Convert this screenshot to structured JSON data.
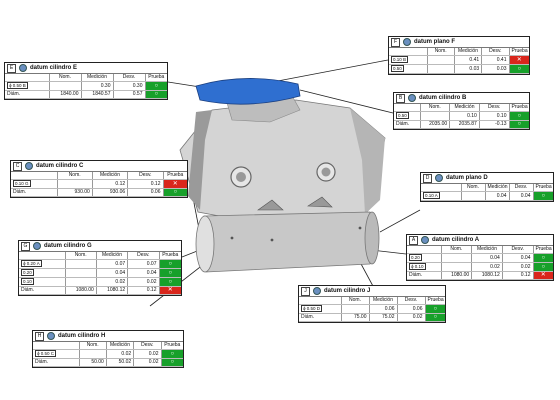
{
  "colors": {
    "ok": "#17a02a",
    "bad": "#d9261c",
    "top_face": "#2f6fd0",
    "body": "#d4d4d4"
  },
  "icons": {
    "datum": "datum-cylinder-icon",
    "ok": "circle-ok-icon",
    "bad": "cross-icon"
  },
  "panels": {
    "E": {
      "letter": "E",
      "title": "datum cilindro E",
      "headers": [
        "Nom.",
        "Medición",
        "Desv.",
        "Prueba"
      ],
      "rows": [
        {
          "fcf": "ϕ 0.50 B",
          "nom": "",
          "med": "0.30",
          "dev": "0.30",
          "status": "ok"
        },
        {
          "label": "Diám.",
          "nom": "1840.00",
          "med": "1840.57",
          "dev": "0.57",
          "status": "ok"
        }
      ]
    },
    "F": {
      "letter": "F",
      "title": "datum plano F",
      "headers": [
        "Nom.",
        "Medición",
        "Desv.",
        "Prueba"
      ],
      "rows": [
        {
          "fcf": "0.10 B",
          "nom": "",
          "med": "0.41",
          "dev": "0.41",
          "status": "bad"
        },
        {
          "fcf": "0.50",
          "nom": "",
          "med": "0.03",
          "dev": "0.03",
          "status": "ok"
        }
      ]
    },
    "B": {
      "letter": "B",
      "title": "datum cilindro B",
      "headers": [
        "Nom.",
        "Medición",
        "Desv.",
        "Prueba"
      ],
      "rows": [
        {
          "fcf": "0.50",
          "nom": "",
          "med": "0.10",
          "dev": "0.10",
          "status": "ok"
        },
        {
          "label": "Diám.",
          "nom": "2035.00",
          "med": "2035.87",
          "dev": "-0.13",
          "status": "ok"
        }
      ]
    },
    "C": {
      "letter": "C",
      "title": "datum cilindro C",
      "headers": [
        "Nom.",
        "Medición",
        "Desv.",
        "Prueba"
      ],
      "rows": [
        {
          "fcf": "0.10 G",
          "nom": "",
          "med": "0.12",
          "dev": "0.12",
          "status": "bad"
        },
        {
          "label": "Diám.",
          "nom": "930.00",
          "med": "930.06",
          "dev": "0.06",
          "status": "ok"
        }
      ]
    },
    "D": {
      "letter": "D",
      "title": "datum plano D",
      "headers": [
        "Nom.",
        "Medición",
        "Desv.",
        "Prueba"
      ],
      "rows": [
        {
          "fcf": "0.10 A",
          "nom": "",
          "med": "0.04",
          "dev": "0.04",
          "status": "ok"
        }
      ]
    },
    "G": {
      "letter": "G",
      "title": "datum cilindro G",
      "headers": [
        "Nom.",
        "Medición",
        "Desv.",
        "Prueba"
      ],
      "rows": [
        {
          "fcf": "ϕ 0.20 A",
          "nom": "",
          "med": "0.07",
          "dev": "0.07",
          "status": "ok"
        },
        {
          "fcf": "0.20",
          "nom": "",
          "med": "0.04",
          "dev": "0.04",
          "status": "ok"
        },
        {
          "fcf": "0.10",
          "nom": "",
          "med": "0.02",
          "dev": "0.02",
          "status": "ok"
        },
        {
          "label": "Diám.",
          "nom": "1080.00",
          "med": "1080.12",
          "dev": "0.12",
          "status": "bad"
        }
      ]
    },
    "A": {
      "letter": "A",
      "title": "datum cilindro A",
      "headers": [
        "Nom.",
        "Medición",
        "Desv.",
        "Prueba"
      ],
      "rows": [
        {
          "fcf": "0.20",
          "nom": "",
          "med": "0.04",
          "dev": "0.04",
          "status": "ok"
        },
        {
          "fcf": "ϕ 0.10",
          "nom": "",
          "med": "0.02",
          "dev": "0.02",
          "status": "ok"
        },
        {
          "label": "Diám.",
          "nom": "1080.00",
          "med": "1080.12",
          "dev": "0.12",
          "status": "bad"
        }
      ]
    },
    "H": {
      "letter": "H",
      "title": "datum cilindro H",
      "headers": [
        "Nom.",
        "Medición",
        "Desv.",
        "Prueba"
      ],
      "rows": [
        {
          "fcf": "ϕ 0.50 C",
          "nom": "",
          "med": "0.02",
          "dev": "0.02",
          "status": "ok"
        },
        {
          "label": "Diám.",
          "nom": "50.00",
          "med": "50.02",
          "dev": "0.02",
          "status": "ok"
        }
      ]
    },
    "J": {
      "letter": "J",
      "title": "datum cilindro J",
      "headers": [
        "Nom.",
        "Medición",
        "Desv.",
        "Prueba"
      ],
      "rows": [
        {
          "fcf": "ϕ 0.50 D",
          "nom": "",
          "med": "0.06",
          "dev": "0.06",
          "status": "ok"
        },
        {
          "label": "Diám.",
          "nom": "75.00",
          "med": "75.02",
          "dev": "0.02",
          "status": "ok"
        }
      ]
    }
  }
}
